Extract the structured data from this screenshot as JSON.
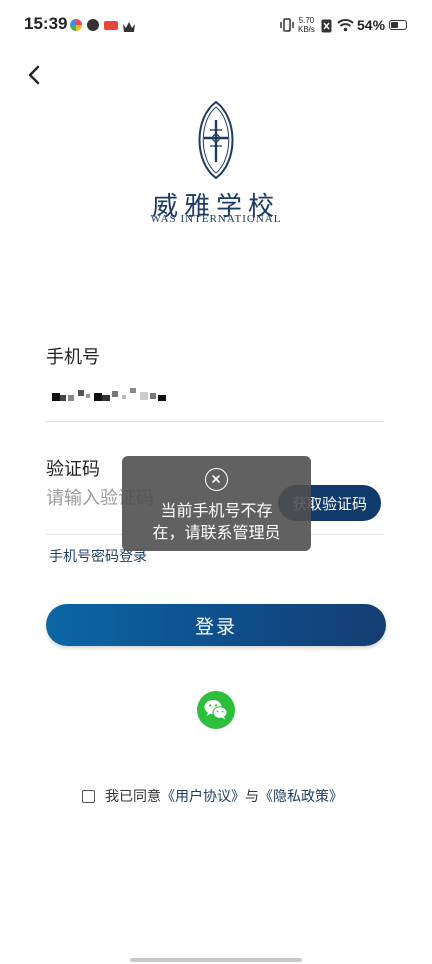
{
  "status_bar": {
    "time": "15:39",
    "net_speed_value": "5.70",
    "net_speed_unit": "KB/s",
    "battery_percent": "54%",
    "battery_level": 0.54
  },
  "header": {
    "brand_name_cn": "威雅学校",
    "brand_name_en": "WAS INTERNATIONAL"
  },
  "form": {
    "phone_label": "手机号",
    "code_label": "验证码",
    "code_placeholder": "请输入验证码",
    "get_code_button": "获取验证码",
    "password_login_link": "手机号密码登录",
    "login_button": "登录"
  },
  "agreement": {
    "prefix": "我已同意",
    "user_agreement": "《用户协议》",
    "joiner": "与",
    "privacy_policy": "《隐私政策》"
  },
  "toast": {
    "line1": "当前手机号不存",
    "line2": "在，请联系管理员"
  },
  "colors": {
    "brand_navy": "#1c3a64",
    "button_navy": "#103a6c",
    "wechat_green": "#2bbf3c"
  }
}
